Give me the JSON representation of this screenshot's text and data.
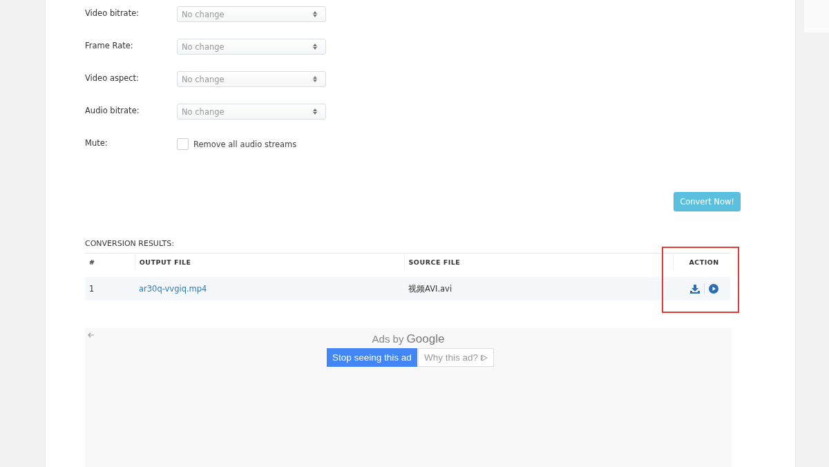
{
  "settings": [
    {
      "label": "Video bitrate:",
      "value": "No change"
    },
    {
      "label": "Frame Rate:",
      "value": "No change"
    },
    {
      "label": "Video aspect:",
      "value": "No change"
    },
    {
      "label": "Audio bitrate:",
      "value": "No change"
    }
  ],
  "mute": {
    "label": "Mute:",
    "option": "Remove all audio streams",
    "checked": false
  },
  "convert_button": "Convert Now!",
  "results": {
    "title": "CONVERSION RESULTS:",
    "columns": [
      "#",
      "OUTPUT FILE",
      "SOURCE FILE",
      "ACTION"
    ],
    "rows": [
      {
        "index": "1",
        "output": "ar30q-vvgiq.mp4",
        "source": "视频AVI.avi"
      }
    ],
    "action_highlighted": true
  },
  "ad": {
    "ads_by": "Ads by",
    "brand": "Google",
    "stop_button": "Stop seeing this ad",
    "why_button": "Why this ad?"
  }
}
